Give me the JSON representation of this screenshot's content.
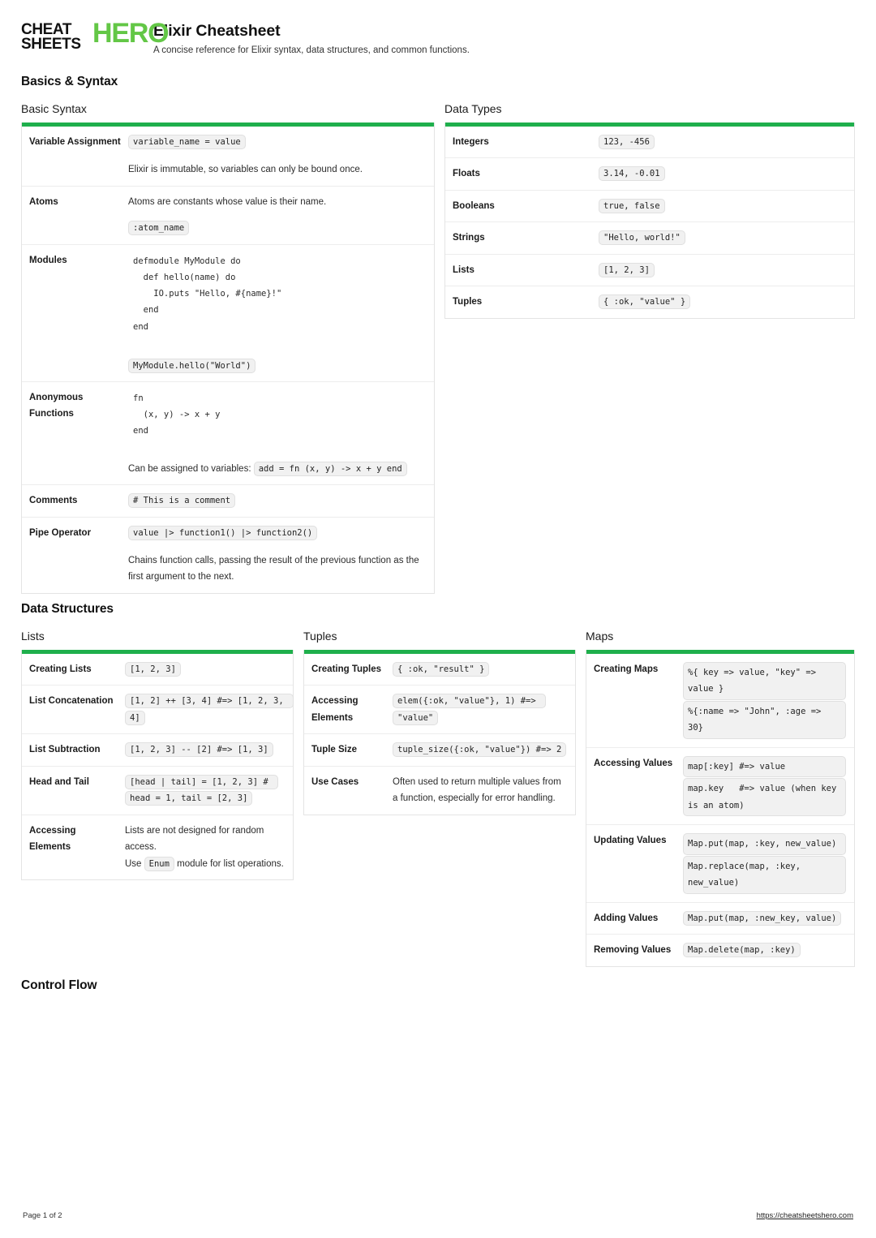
{
  "brand": {
    "line1": "CHEAT",
    "line2": "SHEETS",
    "hero": "HERO",
    "accent_green": "#1faf4c",
    "logo_green": "#63c746"
  },
  "header": {
    "title": "Elixir Cheatsheet",
    "subtitle": "A concise reference for Elixir syntax, data structures, and common functions."
  },
  "sections": [
    {
      "heading": "Basics & Syntax"
    },
    {
      "heading": "Data Structures"
    },
    {
      "heading": "Control Flow"
    }
  ],
  "basic_syntax": {
    "title": "Basic Syntax",
    "rows": {
      "variable_assignment": {
        "label": "Variable Assignment",
        "code": "variable_name = value",
        "note": "Elixir is immutable, so variables can only be bound once."
      },
      "atoms": {
        "label": "Atoms",
        "note": "Atoms are constants whose value is their name.",
        "code": ":atom_name"
      },
      "modules": {
        "label": "Modules",
        "block": "defmodule MyModule do\n  def hello(name) do\n    IO.puts \"Hello, #{name}!\"\n  end\nend",
        "code": "MyModule.hello(\"World\")"
      },
      "anonymous_functions": {
        "label": "Anonymous Functions",
        "block": "fn\n  (x, y) -> x + y\nend",
        "note_prefix": "Can be assigned to variables:",
        "code": "add = fn (x, y) -> x + y end"
      },
      "comments": {
        "label": "Comments",
        "code": "# This is a comment"
      },
      "pipe_operator": {
        "label": "Pipe Operator",
        "code": "value |> function1() |> function2()",
        "note": "Chains function calls, passing the result of the previous function as the first argument to the next."
      }
    }
  },
  "data_types": {
    "title": "Data Types",
    "rows": [
      {
        "label": "Integers",
        "code": "123, -456"
      },
      {
        "label": "Floats",
        "code": "3.14, -0.01"
      },
      {
        "label": "Booleans",
        "code": "true, false"
      },
      {
        "label": "Strings",
        "code": "\"Hello, world!\""
      },
      {
        "label": "Lists",
        "code": "[1, 2, 3]"
      },
      {
        "label": "Tuples",
        "code": "{ :ok, \"value\" }"
      }
    ]
  },
  "lists": {
    "title": "Lists",
    "rows": {
      "creating": {
        "label": "Creating Lists",
        "code": "[1, 2, 3]"
      },
      "concatenation": {
        "label": "List Concatenation",
        "code": "[1, 2] ++ [3, 4] #=> [1, 2, 3, 4]"
      },
      "subtraction": {
        "label": "List Subtraction",
        "code": "[1, 2, 3] -- [2] #=> [1, 3]"
      },
      "head_tail": {
        "label": "Head and Tail",
        "code": "[head | tail] = [1, 2, 3] # head = 1, tail = [2, 3]"
      },
      "accessing": {
        "label": "Accessing Elements",
        "note1": "Lists are not designed for random access.",
        "note2_prefix": "Use",
        "note2_code": "Enum",
        "note2_suffix": "module for list operations."
      }
    }
  },
  "tuples": {
    "title": "Tuples",
    "rows": {
      "creating": {
        "label": "Creating Tuples",
        "code": "{ :ok, \"result\" }"
      },
      "accessing": {
        "label": "Accessing Elements",
        "code": "elem({:ok, \"value\"}, 1) #=> \"value\""
      },
      "size": {
        "label": "Tuple Size",
        "code": "tuple_size({:ok, \"value\"}) #=> 2"
      },
      "use_cases": {
        "label": "Use Cases",
        "note": "Often used to return multiple values from a function, especially for error handling."
      }
    }
  },
  "maps": {
    "title": "Maps",
    "rows": {
      "creating": {
        "label": "Creating Maps",
        "code1": "%{ key => value, \"key\" => value }",
        "code2": "%{:name => \"John\", :age => 30}"
      },
      "accessing": {
        "label": "Accessing Values",
        "code1": "map[:key] #=> value",
        "code2": "map.key   #=> value (when key is an atom)"
      },
      "updating": {
        "label": "Updating Values",
        "code1": "Map.put(map, :key, new_value)",
        "code2": "Map.replace(map, :key, new_value)"
      },
      "adding": {
        "label": "Adding Values",
        "code": "Map.put(map, :new_key, value)"
      },
      "removing": {
        "label": "Removing Values",
        "code": "Map.delete(map, :key)"
      }
    }
  },
  "footer": {
    "page": "Page 1 of 2",
    "url": "https://cheatsheetshero.com"
  }
}
